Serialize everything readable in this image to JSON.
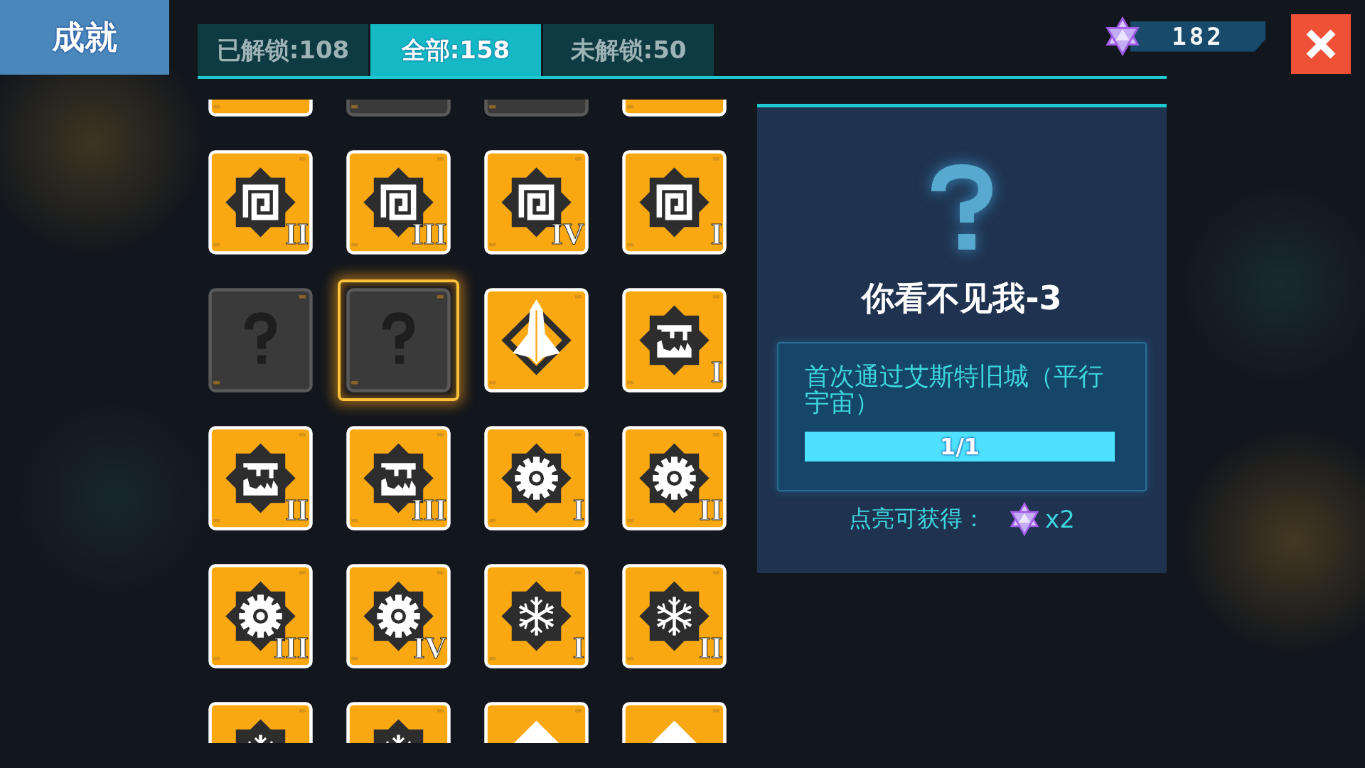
{
  "title": "成就",
  "tabs": [
    {
      "label": "已解锁:108",
      "selected": false
    },
    {
      "label": "全部:158",
      "selected": true
    },
    {
      "label": "未解锁:50",
      "selected": false
    }
  ],
  "currency": {
    "amount": "182"
  },
  "achievements": [
    {
      "kind": "plain",
      "selected": false
    },
    {
      "kind": "locked",
      "selected": false
    },
    {
      "kind": "locked",
      "selected": false
    },
    {
      "kind": "plain",
      "selected": false
    },
    {
      "kind": "spiral",
      "numeral": "II",
      "selected": false
    },
    {
      "kind": "spiral",
      "numeral": "III",
      "selected": false
    },
    {
      "kind": "spiral",
      "numeral": "IV",
      "selected": false
    },
    {
      "kind": "spiral",
      "numeral": "I",
      "selected": false
    },
    {
      "kind": "locked",
      "selected": false
    },
    {
      "kind": "locked",
      "selected": true
    },
    {
      "kind": "ship",
      "selected": false
    },
    {
      "kind": "cave",
      "numeral": "I",
      "selected": false
    },
    {
      "kind": "cave",
      "numeral": "II",
      "selected": false
    },
    {
      "kind": "cave",
      "numeral": "III",
      "selected": false
    },
    {
      "kind": "gear",
      "numeral": "I",
      "selected": false
    },
    {
      "kind": "gear",
      "numeral": "II",
      "selected": false
    },
    {
      "kind": "gear",
      "numeral": "III",
      "selected": false
    },
    {
      "kind": "gear",
      "numeral": "IV",
      "selected": false
    },
    {
      "kind": "snowflake",
      "numeral": "I",
      "selected": false
    },
    {
      "kind": "snowflake",
      "numeral": "II",
      "selected": false
    },
    {
      "kind": "snowflake",
      "selected": false
    },
    {
      "kind": "snowflake",
      "selected": false
    },
    {
      "kind": "diamond",
      "selected": false
    },
    {
      "kind": "diamond",
      "selected": false
    }
  ],
  "detail": {
    "title": "你看不见我-3",
    "description": "首次通过艾斯特旧城（平行宇宙）",
    "progress": {
      "level": 1,
      "reading": "1/1"
    },
    "reward": {
      "label": "点亮可获得：",
      "amount": "x2"
    }
  }
}
